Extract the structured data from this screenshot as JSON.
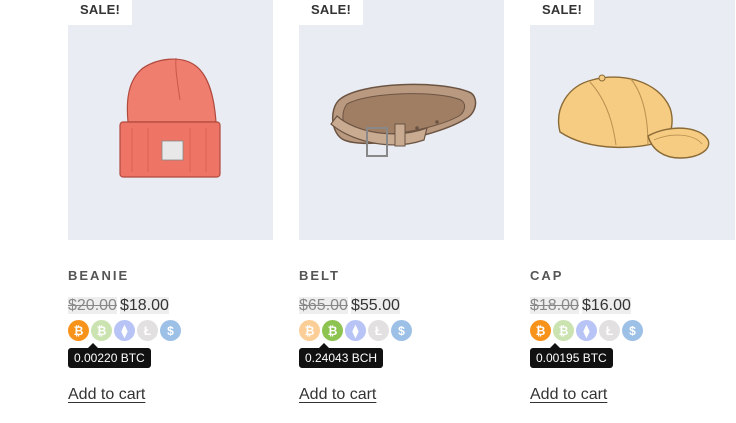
{
  "products": [
    {
      "badge": "SALE!",
      "title": "BEANIE",
      "old_price": "$20.00",
      "new_price": "$18.00",
      "tooltip": "0.00220 BTC",
      "add_to_cart": "Add to cart",
      "image_icon": "beanie-image",
      "coins": [
        {
          "name": "bitcoin-icon",
          "symbol": "₿",
          "color": "#f7931a",
          "active": true
        },
        {
          "name": "bitcoin-cash-icon",
          "symbol": "₿",
          "color": "#8dc351",
          "active": false
        },
        {
          "name": "ethereum-icon",
          "symbol": "⧫",
          "color": "#627eea",
          "active": false
        },
        {
          "name": "litecoin-icon",
          "symbol": "Ł",
          "color": "#bfbbbb",
          "active": false
        },
        {
          "name": "usd-coin-icon",
          "symbol": "$",
          "color": "#2775ca",
          "active": false
        }
      ]
    },
    {
      "badge": "SALE!",
      "title": "BELT",
      "old_price": "$65.00",
      "new_price": "$55.00",
      "tooltip": "0.24043 BCH",
      "add_to_cart": "Add to cart",
      "image_icon": "belt-image",
      "coins": [
        {
          "name": "bitcoin-icon",
          "symbol": "₿",
          "color": "#f7931a",
          "active": false
        },
        {
          "name": "bitcoin-cash-icon",
          "symbol": "₿",
          "color": "#8dc351",
          "active": true
        },
        {
          "name": "ethereum-icon",
          "symbol": "⧫",
          "color": "#627eea",
          "active": false
        },
        {
          "name": "litecoin-icon",
          "symbol": "Ł",
          "color": "#bfbbbb",
          "active": false
        },
        {
          "name": "usd-coin-icon",
          "symbol": "$",
          "color": "#2775ca",
          "active": false
        }
      ]
    },
    {
      "badge": "SALE!",
      "title": "CAP",
      "old_price": "$18.00",
      "new_price": "$16.00",
      "tooltip": "0.00195 BTC",
      "add_to_cart": "Add to cart",
      "image_icon": "cap-image",
      "coins": [
        {
          "name": "bitcoin-icon",
          "symbol": "₿",
          "color": "#f7931a",
          "active": true
        },
        {
          "name": "bitcoin-cash-icon",
          "symbol": "₿",
          "color": "#8dc351",
          "active": false
        },
        {
          "name": "ethereum-icon",
          "symbol": "⧫",
          "color": "#627eea",
          "active": false
        },
        {
          "name": "litecoin-icon",
          "symbol": "Ł",
          "color": "#bfbbbb",
          "active": false
        },
        {
          "name": "usd-coin-icon",
          "symbol": "$",
          "color": "#2775ca",
          "active": false
        }
      ]
    }
  ]
}
